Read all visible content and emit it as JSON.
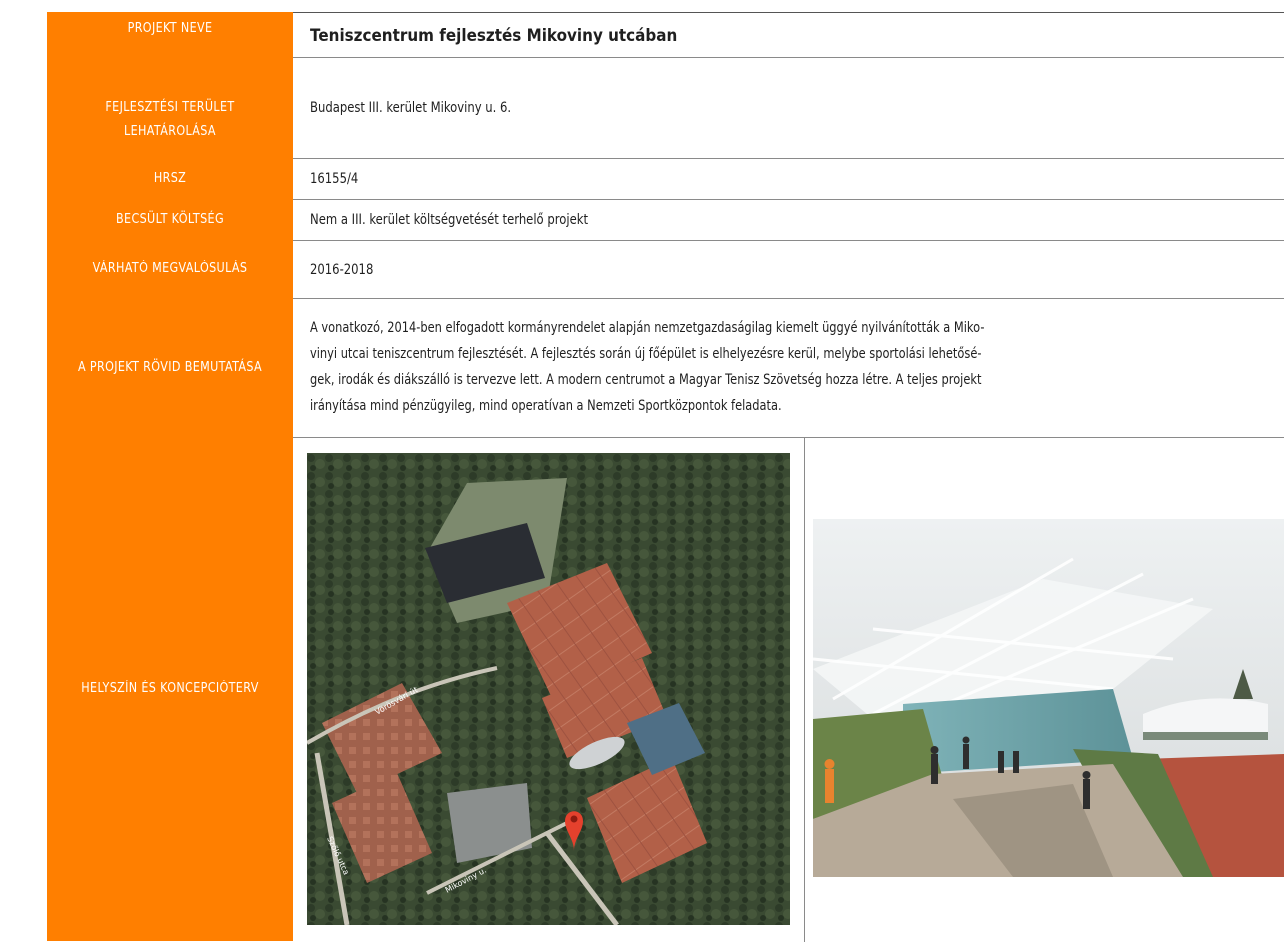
{
  "labels": {
    "project_name": "PROJEKT NEVE",
    "area_line1": "FEJLESZTÉSI TERÜLET",
    "area_line2": "LEHATÁROLÁSA",
    "hrsz": "HRSZ",
    "cost": "BECSÜLT KÖLTSÉG",
    "timeline": "VÁRHATÓ MEGVALÓSULÁS",
    "summary": "A PROJEKT RÖVID BEMUTATÁSA",
    "location": "HELYSZÍN ÉS KONCEPCIÓTERV"
  },
  "values": {
    "project_name": "Teniszcentrum fejlesztés Mikoviny utcában",
    "area": "Budapest III. kerület Mikoviny u. 6.",
    "hrsz": "16155/4",
    "cost": "Nem a III. kerület költségvetését terhelő projekt",
    "timeline": "2016-2018",
    "summary_lines": [
      "A vonatkozó, 2014-ben elfogadott kormányrendelet alapján nemzetgazdaságilag kiemelt üggyé nyilvánították a Miko-",
      "vinyi utcai teniszcentrum fejlesztését. A fejlesztés során új főépület is elhelyezésre kerül, melybe sportolási lehetősé-",
      "gek, irodák és diákszálló is tervezve lett. A modern centrumot a Magyar Tenisz Szövetség hozza létre. A teljes projekt",
      "irányítása mind pénzügyileg, mind operatívan a Nemzeti Sportközpontok feladata."
    ]
  },
  "map": {
    "street_labels": [
      "Vörösvári út",
      "Szőlő utca",
      "Mikoviny u."
    ]
  },
  "colors": {
    "label_column": "#ff7f00",
    "label_text": "#ffffff",
    "map_pin": "#e5412d",
    "clay_court": "#b26048"
  }
}
